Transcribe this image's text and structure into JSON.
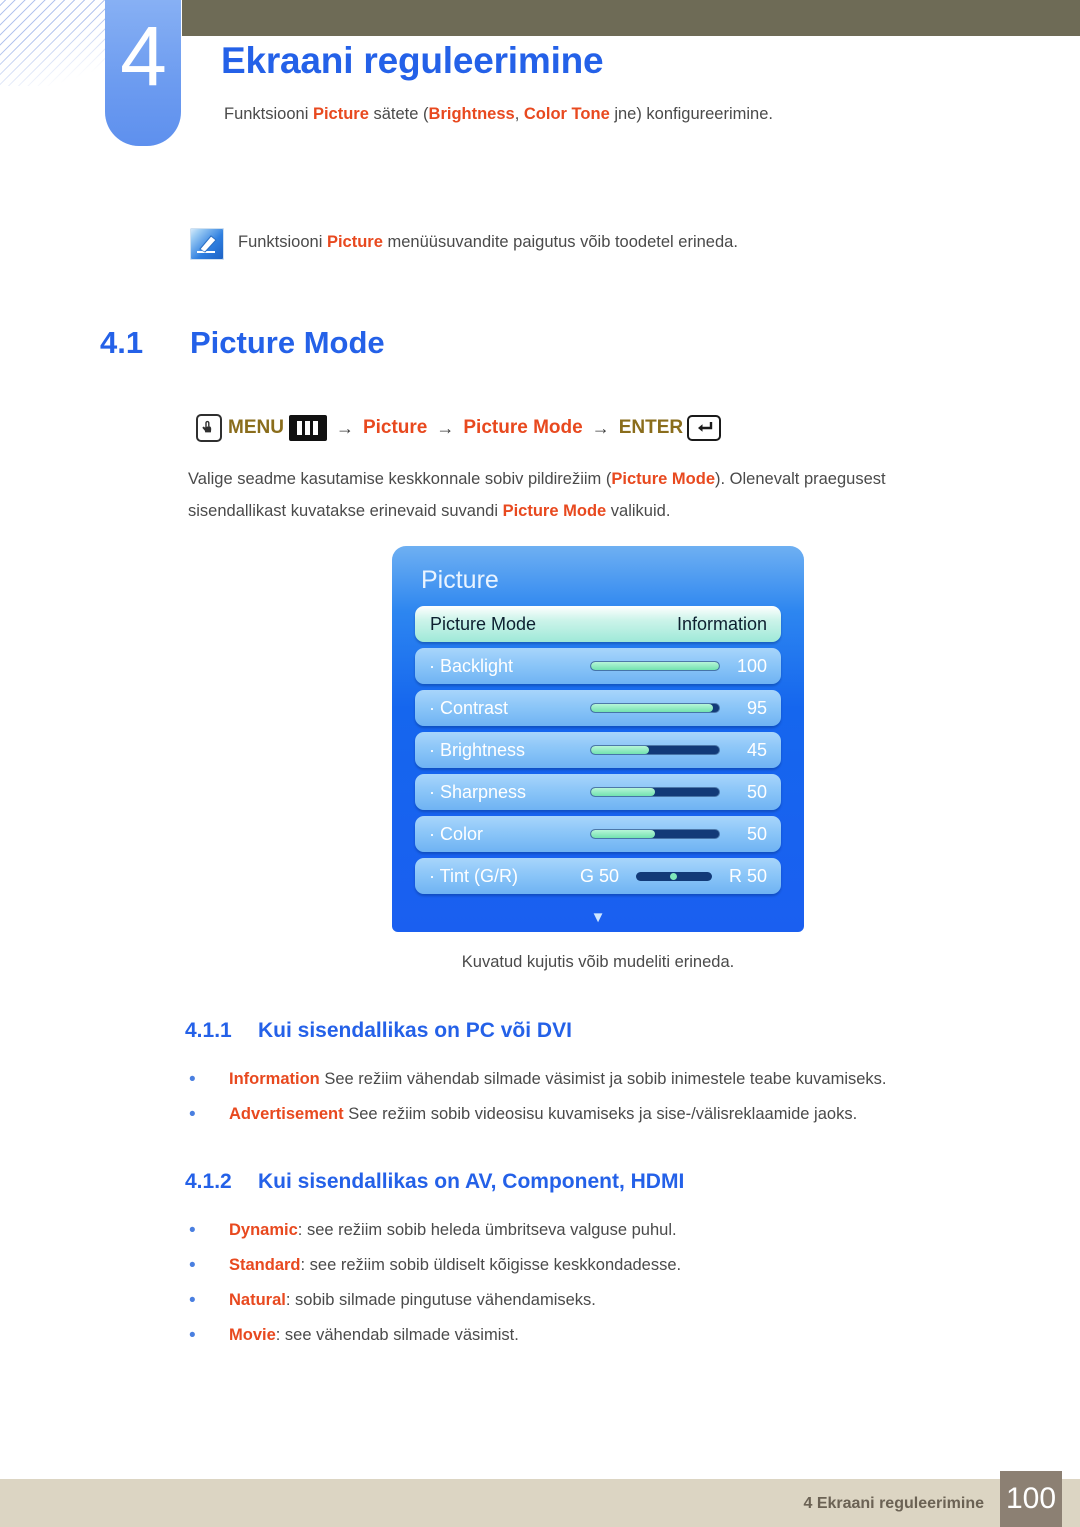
{
  "chapter": {
    "number": "4",
    "title": "Ekraani reguleerimine",
    "subtitle_pre": "Funktsiooni ",
    "subtitle_hl1": "Picture",
    "subtitle_mid1": " sätete (",
    "subtitle_hl2": "Brightness",
    "subtitle_mid2": ", ",
    "subtitle_hl3": "Color Tone",
    "subtitle_post": " jne) konfigureerimine."
  },
  "note": {
    "icon": "note-pencil-icon",
    "pre": "Funktsiooni ",
    "hl": "Picture",
    "post": " menüüsuvandite paigutus võib toodetel erineda."
  },
  "section": {
    "number": "4.1",
    "title": "Picture Mode"
  },
  "menu_path": {
    "touch_icon": "touch-hand-icon",
    "menu_label": "MENU",
    "menu_icon": "menu-bars-icon",
    "arrow": "→",
    "item1": "Picture",
    "item2": "Picture Mode",
    "enter_label": "ENTER",
    "enter_icon": "enter-return-icon"
  },
  "paragraph": {
    "p1": "Valige seadme kasutamise keskkonnale sobiv pildirežiim (",
    "hl1": "Picture Mode",
    "p2": "). Olenevalt praegusest sisendallikast kuvatakse erinevaid suvandi ",
    "hl2": "Picture Mode",
    "p3": " valikuid."
  },
  "osd": {
    "title": "Picture",
    "caret": "▼",
    "rows": [
      {
        "label": "Picture Mode",
        "value": "Information",
        "type": "select",
        "selected": true
      },
      {
        "label": "· Backlight",
        "value": "100",
        "type": "slider",
        "percent": 100,
        "selected": false
      },
      {
        "label": "· Contrast",
        "value": "95",
        "type": "slider",
        "percent": 95,
        "selected": false
      },
      {
        "label": "· Brightness",
        "value": "45",
        "type": "slider",
        "percent": 45,
        "selected": false
      },
      {
        "label": "· Sharpness",
        "value": "50",
        "type": "slider",
        "percent": 50,
        "selected": false
      },
      {
        "label": "· Color",
        "value": "50",
        "type": "slider",
        "percent": 50,
        "selected": false
      },
      {
        "label": "· Tint (G/R)",
        "type": "tint",
        "left_value": "G 50",
        "right_value": "R 50",
        "selected": false
      }
    ]
  },
  "caption": "Kuvatud kujutis võib mudeliti erineda.",
  "subsections": [
    {
      "number": "4.1.1",
      "title": "Kui sisendallikas on PC või DVI",
      "bullets": [
        {
          "term": "Information",
          "sep": " ",
          "text": "See režiim vähendab silmade väsimist ja sobib inimestele teabe kuvamiseks."
        },
        {
          "term": "Advertisement",
          "sep": " ",
          "text": "See režiim sobib videosisu kuvamiseks ja sise-/välisreklaamide jaoks."
        }
      ]
    },
    {
      "number": "4.1.2",
      "title": "Kui sisendallikas on AV, Component, HDMI",
      "bullets": [
        {
          "term": "Dynamic",
          "sep": ": ",
          "text": "see režiim sobib heleda ümbritseva valguse puhul."
        },
        {
          "term": "Standard",
          "sep": ": ",
          "text": "see režiim sobib üldiselt kõigisse keskkondadesse."
        },
        {
          "term": "Natural",
          "sep": ": ",
          "text": "sobib silmade pingutuse vähendamiseks."
        },
        {
          "term": "Movie",
          "sep": ": ",
          "text": "see vähendab silmade väsimist."
        }
      ]
    }
  ],
  "footer": {
    "text": "4 Ekraani reguleerimine",
    "page": "100"
  },
  "colors": {
    "accent_blue": "#2461e8",
    "highlight_orange": "#e8491f",
    "header_olive": "#6e6b56",
    "footer_beige": "#dcd5c3",
    "footer_page_box": "#8c8073",
    "tab_blue": "#6d9cf0"
  }
}
